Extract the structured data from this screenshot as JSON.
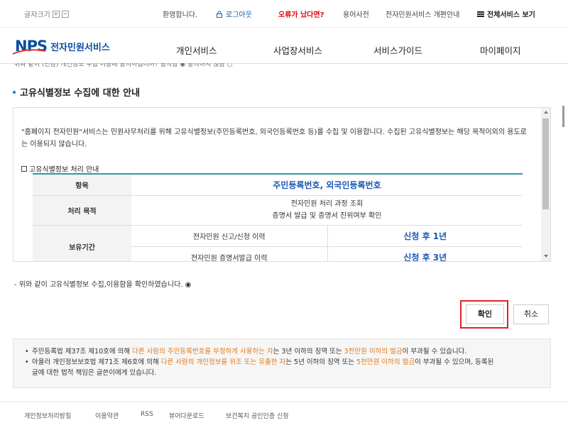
{
  "topbar": {
    "font_size_label": "글자크기",
    "font_plus": "+",
    "font_minus": "−",
    "welcome": "환영합니다.",
    "logout": "로그아웃",
    "error": "오류가 났다면?",
    "dictionary": "용어사전",
    "reorg_guide": "전자민원서비스 개편안내",
    "all_services": "전체서비스 보기"
  },
  "header": {
    "logo_nps": "NPS",
    "logo_text": "전자민원서비스",
    "menus": [
      "개인서비스",
      "사업장서비스",
      "서비스가이드",
      "마이페이지"
    ]
  },
  "main": {
    "clipped_text": "위와 같이 (민감) 개인정보 수집 이용에 동의하십니까?   동의함 ◉     동의하지 않음  ○",
    "section_title": "고유식별정보 수집에 대한 안내",
    "description": "\"홈페이지 전자민원\"서비스는 민원사무처리를 위해 고유식별정보(주민등록번호, 외국인등록번호 등)를 수집 및 이용합니다. 수집된 고유식별정보는 해당 목적이외의 용도로는 이용되지 않습니다.",
    "table_caption": "고유식별정보 처리 안내",
    "table": {
      "item_header": "항목",
      "item_value": "주민등록번호, 외국인등록번호",
      "purpose_header": "처리 목적",
      "purpose_line1": "전자민원 처리 과정 조회",
      "purpose_line2": "증명서 발급 및 증명서 진위여부 확인",
      "period_header": "보유기간",
      "period_rows": [
        {
          "label": "전자민원 신고/신청 이력",
          "value": "신청 후 1년"
        },
        {
          "label": "전자민원 증명서발급 이력",
          "value": "신청 후 3년"
        }
      ]
    },
    "confirm_text": "- 위와 같이 고유식별정보 수집,이용함을 확인하였습니다. ◉",
    "ok_button": "확인",
    "cancel_button": "취소"
  },
  "notice": {
    "line1": {
      "pre": "주민등록법 제37조 제10호에 의해 ",
      "hl1": "다른 사람의 주민등록번호를 부정하게 사용하는 자",
      "mid1": "는 3년 이하의 징역 또는 ",
      "hl2": "3천만원 이하의 벌금",
      "post": "이 부과될 수 있습니다."
    },
    "line2": {
      "pre": "아울러 개인정보보호법 제71조 제6호에 의해 ",
      "hl1": "다른 사람의 개인정보를 위조 또는 유출한 자",
      "mid1": "는 5년 이하의 징역 또는 ",
      "hl2": "5천만원 이하의 벌금",
      "post": "이 부과될 수 있으며, 등록된",
      "cont": "글에 대한 법적 책임은 글쓴이에게 있습니다."
    }
  },
  "footer": {
    "links": [
      "개인정보처리방침",
      "이용약관",
      "RSS",
      "뷰어다운로드",
      "보건복지 공인인증 신청"
    ]
  },
  "colors": {
    "brand_blue": "#0b4ea2",
    "error_red": "#e60012",
    "highlight_orange": "#e07a1f",
    "table_value_blue": "#1a56b3",
    "focus_outline": "#e0202a"
  }
}
